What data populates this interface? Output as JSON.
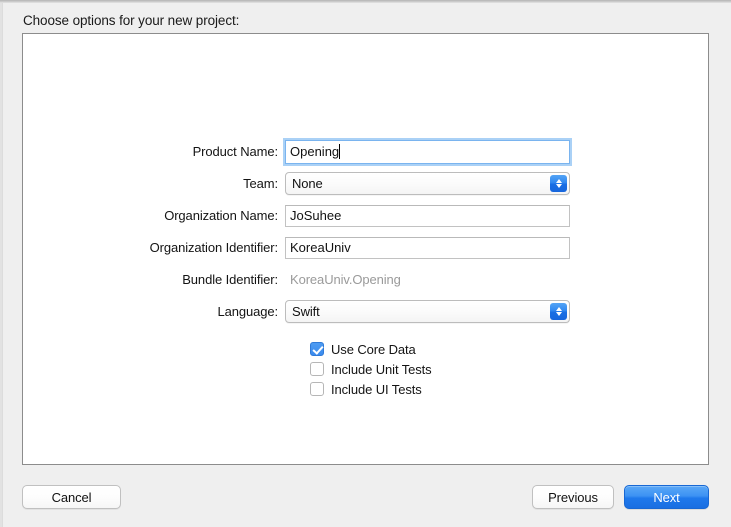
{
  "heading": "Choose options for your new project:",
  "form": {
    "product_name": {
      "label": "Product Name:",
      "value": "Opening",
      "placeholder": ""
    },
    "team": {
      "label": "Team:",
      "value": "None",
      "options": [
        "None"
      ]
    },
    "organization_name": {
      "label": "Organization Name:",
      "value": "JoSuhee",
      "placeholder": ""
    },
    "organization_identifier": {
      "label": "Organization Identifier:",
      "value": "KoreaUniv",
      "placeholder": ""
    },
    "bundle_identifier": {
      "label": "Bundle Identifier:",
      "value": "KoreaUniv.Opening"
    },
    "language": {
      "label": "Language:",
      "value": "Swift",
      "options": [
        "Swift"
      ]
    }
  },
  "checkboxes": [
    {
      "label": "Use Core Data",
      "checked": true
    },
    {
      "label": "Include Unit Tests",
      "checked": false
    },
    {
      "label": "Include UI Tests",
      "checked": false
    }
  ],
  "buttons": {
    "cancel": "Cancel",
    "previous": "Previous",
    "next": "Next"
  },
  "colors": {
    "accent": "#3d92f3",
    "focus_ring": "#65abee",
    "panel_border": "#8c8c8c",
    "window_background": "#efefef",
    "disabled_text": "#9a9a9a"
  }
}
